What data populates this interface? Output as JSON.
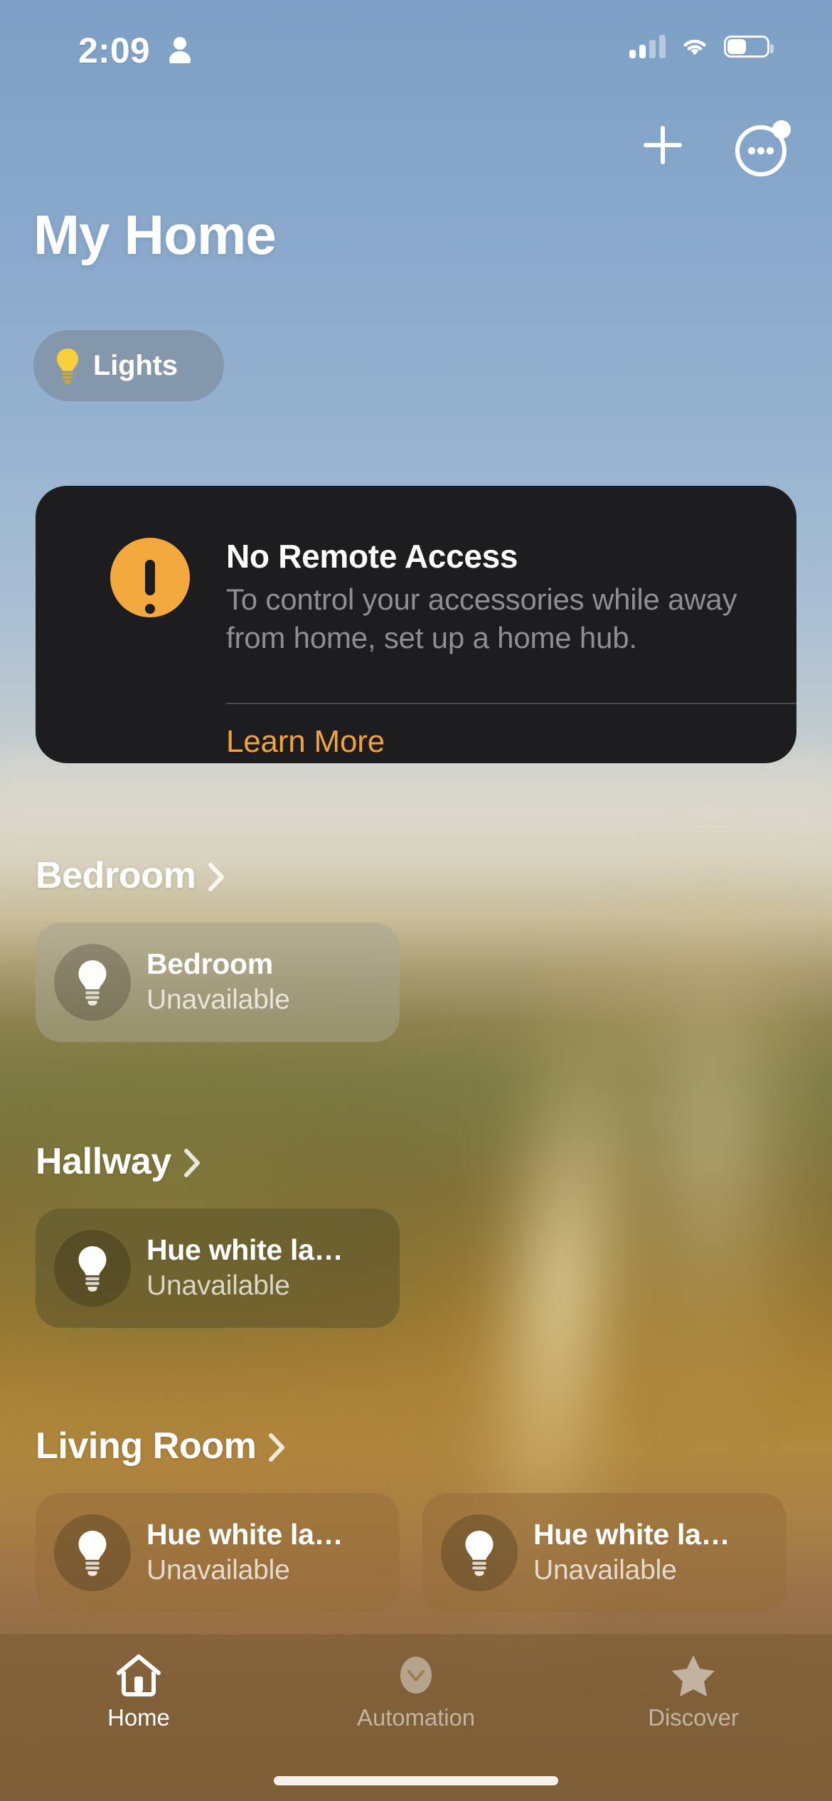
{
  "status_bar": {
    "time": "2:09",
    "person_icon": "person-icon",
    "cellular_icon": "cellular-signal-icon",
    "cellular_bars_filled": 2,
    "cellular_bars_total": 4,
    "wifi_icon": "wifi-icon",
    "battery_icon": "battery-icon",
    "battery_percent": 45
  },
  "nav": {
    "add_icon": "plus-icon",
    "more_icon": "ellipsis-circle-icon",
    "more_has_badge": true
  },
  "header": {
    "title": "My Home"
  },
  "filter_chip": {
    "icon": "lightbulb-icon",
    "label": "Lights"
  },
  "alert": {
    "icon": "exclamation-circle-icon",
    "title": "No Remote Access",
    "body": "To control your accessories while away from home, set up a home hub.",
    "link_label": "Learn More",
    "accent_color": "#f4a93e",
    "link_color": "#f0a23c",
    "background_color": "#1d1d1f"
  },
  "rooms": [
    {
      "name": "Bedroom",
      "chevron_icon": "chevron-right-icon",
      "tint": "tint-grey",
      "accessories": [
        {
          "icon": "lightbulb-icon",
          "name": "Bedroom",
          "status": "Unavailable"
        }
      ]
    },
    {
      "name": "Hallway",
      "chevron_icon": "chevron-right-icon",
      "tint": "tint-olive",
      "accessories": [
        {
          "icon": "lightbulb-icon",
          "name": "Hue white la…",
          "status": "Unavailable"
        }
      ]
    },
    {
      "name": "Living Room",
      "chevron_icon": "chevron-right-icon",
      "tint": "tint-amber",
      "accessories": [
        {
          "icon": "lightbulb-icon",
          "name": "Hue white la…",
          "status": "Unavailable"
        },
        {
          "icon": "lightbulb-icon",
          "name": "Hue white la…",
          "status": "Unavailable"
        }
      ]
    }
  ],
  "tab_bar": {
    "tabs": [
      {
        "label": "Home",
        "icon": "house-icon",
        "active": true
      },
      {
        "label": "Automation",
        "icon": "checkmark-oval-icon",
        "active": false
      },
      {
        "label": "Discover",
        "icon": "star-icon",
        "active": false
      }
    ]
  }
}
